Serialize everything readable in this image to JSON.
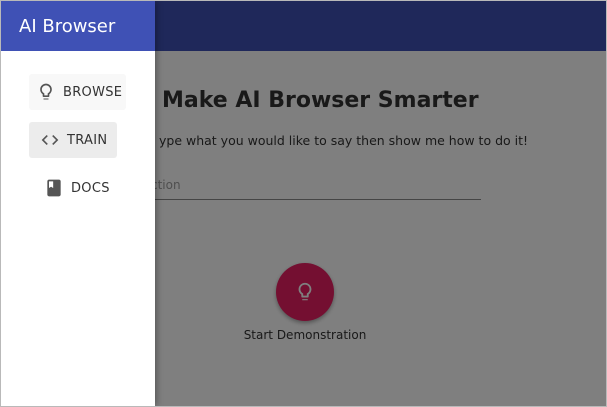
{
  "drawer": {
    "title": "AI Browser",
    "items": [
      {
        "label": "BROWSE",
        "icon": "lightbulb-icon"
      },
      {
        "label": "TRAIN",
        "icon": "code-brackets-icon"
      },
      {
        "label": "DOCS",
        "icon": "book-icon"
      }
    ]
  },
  "main": {
    "title": "Make AI Browser Smarter",
    "subtitle": "ype what you would like to say then show me how to do it!",
    "instruction_placeholder": "ction",
    "demo_button_icon": "lightbulb-icon",
    "demo_label": "Start Demonstration"
  },
  "colors": {
    "primary": "#3f51b5",
    "accent": "#e91e63"
  }
}
